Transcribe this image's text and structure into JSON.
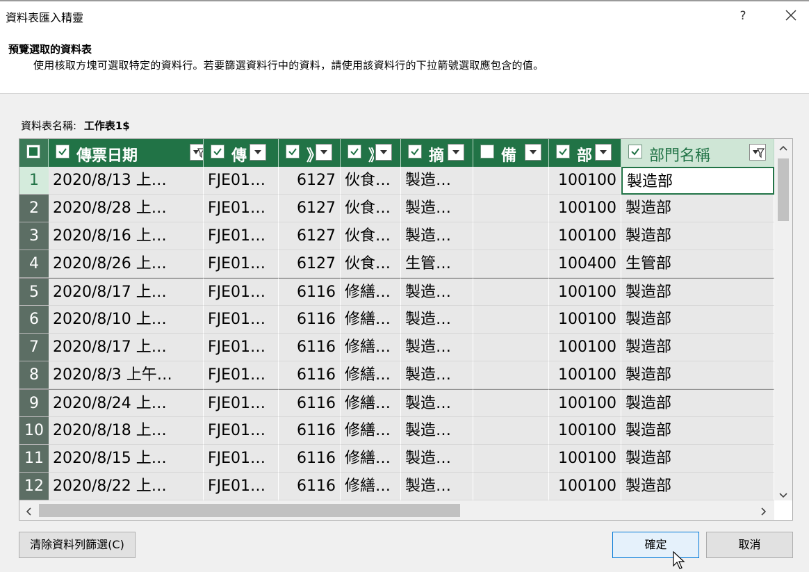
{
  "window": {
    "title": "資料表匯入精靈",
    "help": "?"
  },
  "header": {
    "title": "預覽選取的資料表",
    "description": "使用核取方塊可選取特定的資料行。若要篩選資料行中的資料，請使用該資料行的下拉箭號選取應包含的值。"
  },
  "sheet": {
    "label": "資料表名稱:",
    "name": "工作表1$"
  },
  "columns": [
    {
      "label": "傳票日期",
      "checked": true,
      "filtered": true
    },
    {
      "label": "傳",
      "checked": true,
      "filtered": false
    },
    {
      "label": "》",
      "checked": true,
      "filtered": false
    },
    {
      "label": "》",
      "checked": true,
      "filtered": false
    },
    {
      "label": "摘",
      "checked": true,
      "filtered": false
    },
    {
      "label": "備",
      "checked": false,
      "filtered": false
    },
    {
      "label": "部",
      "checked": true,
      "filtered": false
    },
    {
      "label": "部門名稱",
      "checked": true,
      "filtered": true
    },
    {
      "label": "",
      "checked": false,
      "filtered": false
    }
  ],
  "rows": [
    {
      "n": "1",
      "c": [
        "2020/8/13 上…",
        "FJE01…",
        "6127",
        "伙食…",
        "製造…",
        "",
        "100100",
        "製造部"
      ]
    },
    {
      "n": "2",
      "c": [
        "2020/8/28 上…",
        "FJE01…",
        "6127",
        "伙食…",
        "製造…",
        "",
        "100100",
        "製造部"
      ]
    },
    {
      "n": "3",
      "c": [
        "2020/8/16 上…",
        "FJE01…",
        "6127",
        "伙食…",
        "製造…",
        "",
        "100100",
        "製造部"
      ]
    },
    {
      "n": "4",
      "c": [
        "2020/8/26 上…",
        "FJE01…",
        "6127",
        "伙食…",
        "生管…",
        "",
        "100400",
        "生管部"
      ]
    },
    {
      "n": "5",
      "c": [
        "2020/8/17 上…",
        "FJE01…",
        "6116",
        "修繕…",
        "製造…",
        "",
        "100100",
        "製造部"
      ]
    },
    {
      "n": "6",
      "c": [
        "2020/8/10 上…",
        "FJE01…",
        "6116",
        "修繕…",
        "製造…",
        "",
        "100100",
        "製造部"
      ]
    },
    {
      "n": "7",
      "c": [
        "2020/8/17 上…",
        "FJE01…",
        "6116",
        "修繕…",
        "製造…",
        "",
        "100100",
        "製造部"
      ]
    },
    {
      "n": "8",
      "c": [
        "2020/8/3 上午…",
        "FJE01…",
        "6116",
        "修繕…",
        "製造…",
        "",
        "100100",
        "製造部"
      ]
    },
    {
      "n": "9",
      "c": [
        "2020/8/24 上…",
        "FJE01…",
        "6116",
        "修繕…",
        "製造…",
        "",
        "100100",
        "製造部"
      ]
    },
    {
      "n": "10",
      "c": [
        "2020/8/18 上…",
        "FJE01…",
        "6116",
        "修繕…",
        "製造…",
        "",
        "100100",
        "製造部"
      ]
    },
    {
      "n": "11",
      "c": [
        "2020/8/15 上…",
        "FJE01…",
        "6116",
        "修繕…",
        "製造…",
        "",
        "100100",
        "製造部"
      ]
    },
    {
      "n": "12",
      "c": [
        "2020/8/22 上…",
        "FJE01…",
        "6116",
        "修繕…",
        "製造…",
        "",
        "100100",
        "製造部"
      ]
    }
  ],
  "buttons": {
    "clear_filter": "清除資料列篩選(C)",
    "ok": "確定",
    "cancel": "取消"
  },
  "colors": {
    "header_bg": "#217346",
    "row_header_bg": "#5c6e64",
    "selected_header_bg": "#cfe6d6",
    "cell_bg": "#e8e8e8"
  }
}
